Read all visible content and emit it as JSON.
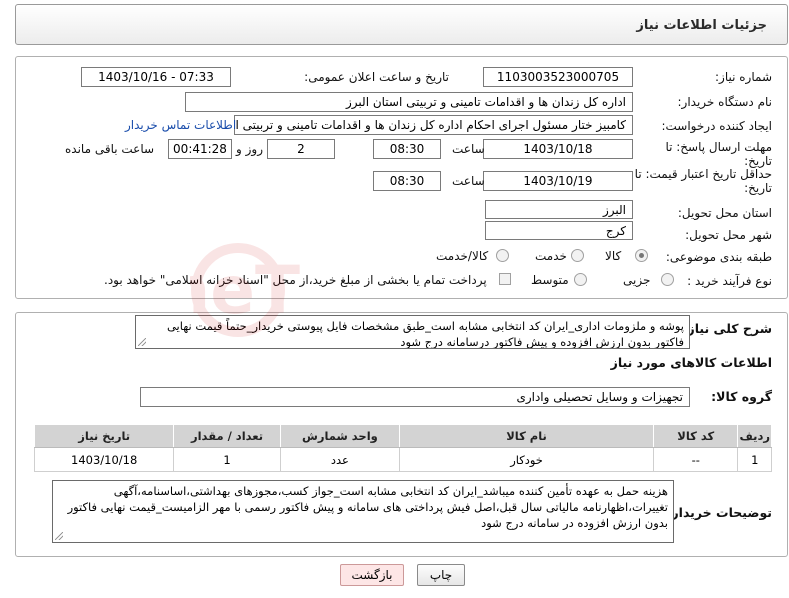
{
  "page": {
    "title": "جزئیات اطلاعات نیاز"
  },
  "form": {
    "need_number": {
      "label": "شماره نیاز:",
      "value": "1103003523000705"
    },
    "announce_datetime": {
      "label": "تاریخ و ساعت اعلان عمومی:",
      "value": "1403/10/16 - 07:33"
    },
    "buyer_org": {
      "label": "نام دستگاه خریدار:",
      "value": "اداره کل زندان ها و اقدامات تامینی و تربیتی استان البرز"
    },
    "creator": {
      "label": "ایجاد کننده درخواست:",
      "value": "کامبیز ختار مسئول اجرای احکام اداره کل زندان ها و اقدامات تامینی و تربیتی استان",
      "contact_link": "اطلاعات تماس خریدار"
    },
    "reply_deadline": {
      "label_line1": "مهلت ارسال پاسخ: تا",
      "label_line2": "تاریخ:",
      "date": "1403/10/18",
      "time_label": "ساعت",
      "time": "08:30",
      "days": "2",
      "days_label": "روز و",
      "remaining": "00:41:28",
      "remaining_label": "ساعت باقی مانده"
    },
    "price_validity": {
      "label_line1": "حداقل تاریخ اعتبار قیمت: تا",
      "label_line2": "تاریخ:",
      "date": "1403/10/19",
      "time_label": "ساعت",
      "time": "08:30"
    },
    "province": {
      "label": "استان محل تحویل:",
      "value": "البرز"
    },
    "city": {
      "label": "شهر محل تحویل:",
      "value": "کرج"
    },
    "category": {
      "label": "طبقه بندی موضوعی:",
      "options": [
        "کالا",
        "خدمت",
        "کالا/خدمت"
      ],
      "selected": "کالا"
    },
    "purchase_type": {
      "label": "نوع فرآیند خرید :",
      "options": [
        "جزیی",
        "متوسط"
      ],
      "payment_note": "پرداخت تمام یا بخشی از مبلغ خرید،از محل \"اسناد خزانه اسلامی\" خواهد بود."
    }
  },
  "description": {
    "label": "شرح کلی نیاز:",
    "text": "پوشه و ملزومات اداری_ایران کد انتخابی مشابه است_طبق مشخصات فایل پیوستی خریدار_حتماً قیمت نهایی فاکتور بدون ارزش افزوده و پیش فاکتور درسامانه درج شود"
  },
  "goods_section": {
    "title": "اطلاعات کالاهای مورد نیاز",
    "group_label": "گروه کالا:",
    "group_value": "تجهیزات و وسایل تحصیلی واداری",
    "table": {
      "headers": [
        "ردیف",
        "کد کالا",
        "نام کالا",
        "واحد شمارش",
        "تعداد / مقدار",
        "تاریخ نیاز"
      ],
      "rows": [
        [
          "1",
          "--",
          "خودکار",
          "عدد",
          "1",
          "1403/10/18"
        ]
      ]
    }
  },
  "buyer_notes": {
    "label": "توضیحات خریدار:",
    "text": "هزینه حمل به عهده تأمین کننده میباشد_ایران کد انتخابی مشابه است_جواز کسب،مجوزهای بهداشتی،اساسنامه،آگهی تغییرات،اظهارنامه مالیاتی سال قبل،اصل فیش پرداختی های سامانه و پیش فاکتور رسمی با مهر الزامیست_قیمت نهایی فاکتور بدون ارزش افزوده در سامانه درج شود"
  },
  "buttons": {
    "print": "چاپ",
    "back": "بازگشت"
  },
  "watermark": {
    "text": "AriaTender.neT"
  }
}
